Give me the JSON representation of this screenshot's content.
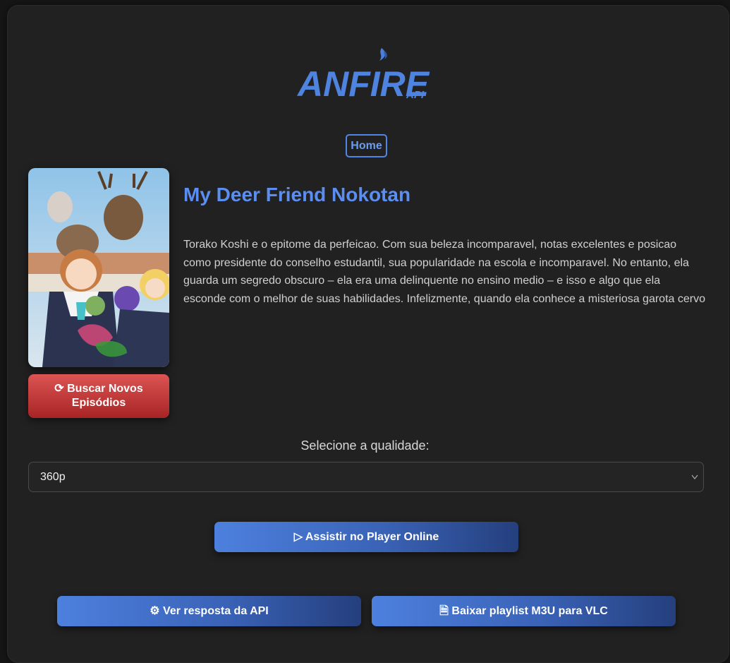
{
  "brand": {
    "name": "ANFIRE",
    "sub": "API"
  },
  "nav": {
    "home_label": "Home"
  },
  "anime": {
    "title": "My Deer Friend Nokotan",
    "description": "Torako Koshi e o epitome da perfeicao. Com sua beleza incomparavel, notas excelentes e posicao como presidente do conselho estudantil, sua popularidade na escola e incomparavel. No entanto, ela guarda um segredo obscuro – ela era uma delinquente no ensino medio – e isso e algo que ela esconde com o melhor de suas habilidades. Infelizmente, quando ela conhece a misteriosa garota cervo"
  },
  "actions": {
    "refresh_label": "⟳ Buscar Novos Episódios",
    "player_label": "▷ Assistir no Player Online",
    "api_label": "⚙ Ver resposta da API",
    "m3u_label": "🗎 Baixar playlist M3U para VLC"
  },
  "quality": {
    "label": "Selecione a qualidade:",
    "selected": "360p"
  },
  "colors": {
    "accent": "#5b8ef0",
    "danger": "#c83a3a",
    "background": "#212121"
  },
  "icons": {
    "refresh": "refresh-icon",
    "play": "play-icon",
    "api": "gear-icon",
    "file": "file-icon",
    "chevron": "chevron-down-icon"
  }
}
